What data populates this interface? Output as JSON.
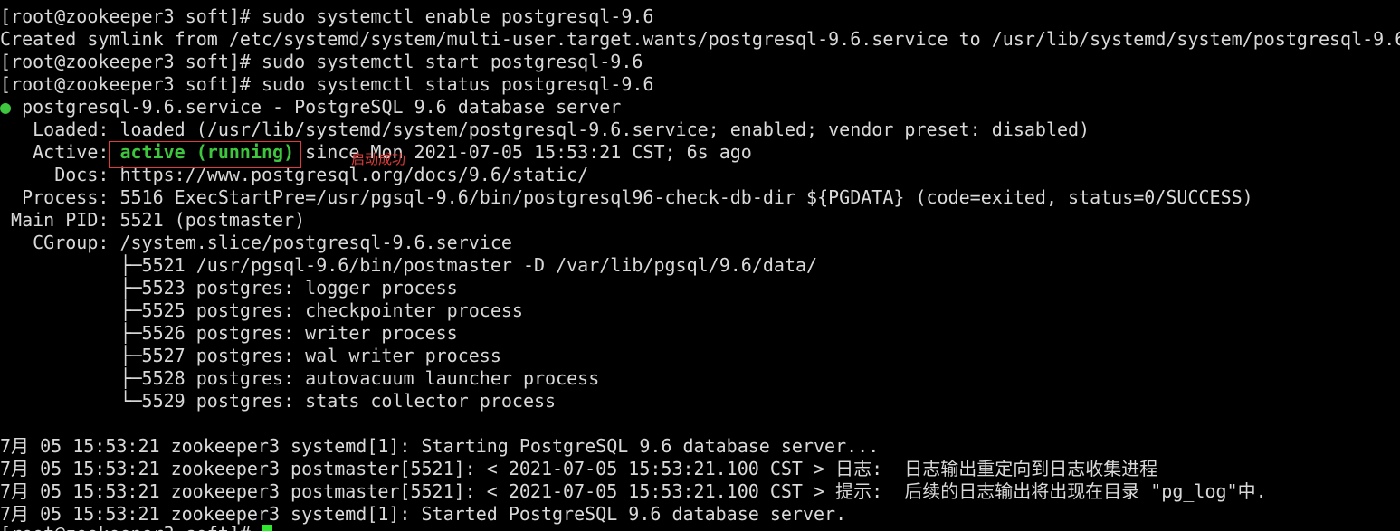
{
  "terminal": {
    "lines": [
      "[root@zookeeper3 soft]# sudo systemctl enable postgresql-9.6",
      "Created symlink from /etc/systemd/system/multi-user.target.wants/postgresql-9.6.service to /usr/lib/systemd/system/postgresql-9.6",
      "[root@zookeeper3 soft]# sudo systemctl start postgresql-9.6",
      "[root@zookeeper3 soft]# sudo systemctl status postgresql-9.6"
    ],
    "status": {
      "dot": "●",
      "header": " postgresql-9.6.service - PostgreSQL 9.6 database server",
      "loaded": "   Loaded: loaded (/usr/lib/systemd/system/postgresql-9.6.service; enabled; vendor preset: disabled)",
      "active_label": "   Active: ",
      "active_state": "active (running)",
      "active_rest": " since Mon 2021-07-05 15:53:21 CST; 6s ago",
      "docs": "     Docs: https://www.postgresql.org/docs/9.6/static/",
      "process": "  Process: 5516 ExecStartPre=/usr/pgsql-9.6/bin/postgresql96-check-db-dir ${PGDATA} (code=exited, status=0/SUCCESS)",
      "main_pid": " Main PID: 5521 (postmaster)",
      "cgroup": "   CGroup: /system.slice/postgresql-9.6.service",
      "tree": [
        "           ├─5521 /usr/pgsql-9.6/bin/postmaster -D /var/lib/pgsql/9.6/data/",
        "           ├─5523 postgres: logger process",
        "           ├─5525 postgres: checkpointer process",
        "           ├─5526 postgres: writer process",
        "           ├─5527 postgres: wal writer process",
        "           ├─5528 postgres: autovacuum launcher process",
        "           └─5529 postgres: stats collector process"
      ]
    },
    "logs": [
      "7月 05 15:53:21 zookeeper3 systemd[1]: Starting PostgreSQL 9.6 database server...",
      "7月 05 15:53:21 zookeeper3 postmaster[5521]: < 2021-07-05 15:53:21.100 CST > 日志:  日志输出重定向到日志收集进程",
      "7月 05 15:53:21 zookeeper3 postmaster[5521]: < 2021-07-05 15:53:21.100 CST > 提示:  后续的日志输出将出现在目录 \"pg_log\"中.",
      "7月 05 15:53:21 zookeeper3 systemd[1]: Started PostgreSQL 9.6 database server."
    ],
    "prompt": "[root@zookeeper3 soft]# "
  },
  "annotation": {
    "text": "启动成功",
    "color": "#e03a3a"
  },
  "colors": {
    "background": "#000000",
    "foreground": "#d9d9d9",
    "active_green": "#3ec73e",
    "cursor": "#2ee82e"
  }
}
